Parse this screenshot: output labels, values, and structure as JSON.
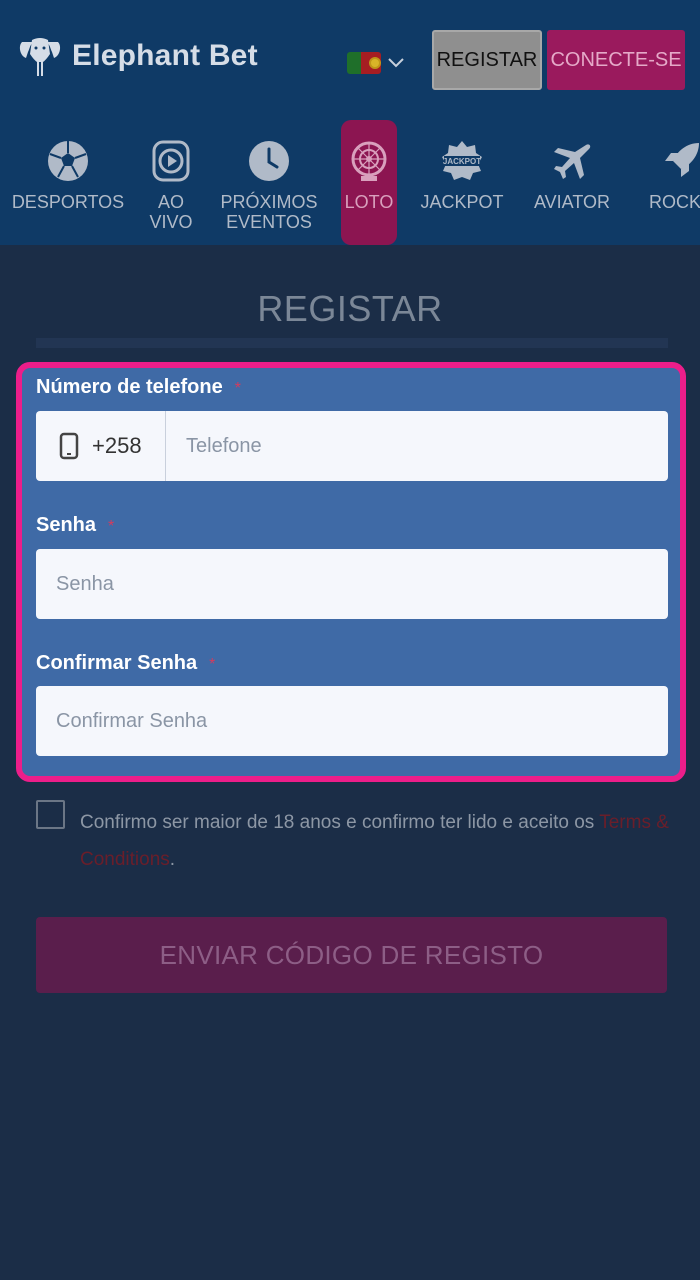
{
  "header": {
    "logo_text": "Elephant Bet",
    "register_label": "REGISTAR",
    "login_label": "CONECTE-SE"
  },
  "nav": {
    "items": [
      {
        "label": "DESPORTOS",
        "icon": "soccer-ball-icon"
      },
      {
        "label": "AO\nVIVO",
        "icon": "live-play-icon"
      },
      {
        "label": "PRÓXIMOS\nEVENTOS",
        "icon": "clock-icon"
      },
      {
        "label": "LOTO",
        "icon": "lottery-wheel-icon"
      },
      {
        "label": "JACKPOT",
        "icon": "jackpot-badge-icon"
      },
      {
        "label": "AVIATOR",
        "icon": "airplane-icon"
      },
      {
        "label": "ROCKE",
        "icon": "rocket-icon"
      }
    ]
  },
  "form": {
    "title": "REGISTAR",
    "phone_label": "Número de telefone",
    "phone_prefix": "+258",
    "phone_placeholder": "Telefone",
    "password_label": "Senha",
    "password_placeholder": "Senha",
    "confirm_label": "Confirmar Senha",
    "confirm_placeholder": "Confirmar Senha",
    "required_mark": "*",
    "consent_text": "Confirmo ser maior de 18 anos e confirmo ter lido e aceito os ",
    "terms_link": "Terms & Conditions",
    "consent_end": ".",
    "submit_label": "ENVIAR CÓDIGO DE REGISTO"
  },
  "colors": {
    "header_bg": "#0f3a66",
    "page_bg": "#1b2d47",
    "form_bg": "#3f6aa6",
    "highlight_border": "#ec1e8a",
    "accent": "#9a1a5d"
  }
}
